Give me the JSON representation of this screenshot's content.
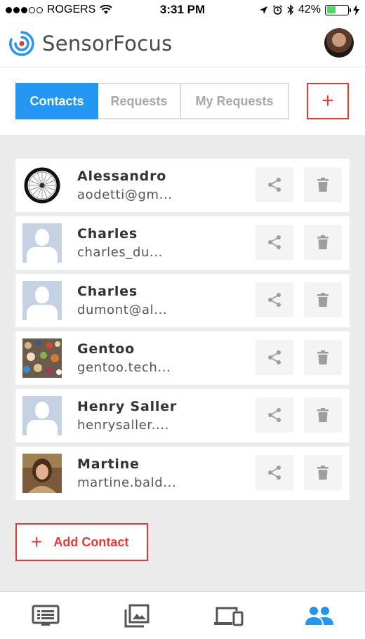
{
  "status_bar": {
    "carrier": "ROGERS",
    "time": "3:31 PM",
    "battery_percent": "42%",
    "battery_level": 0.42
  },
  "header": {
    "app_title": "SensorFocus",
    "logo_icon": "sensor-logo-icon",
    "accent_color": "#2196f3"
  },
  "tabs": [
    {
      "label": "Contacts",
      "active": true
    },
    {
      "label": "Requests",
      "active": false
    },
    {
      "label": "My Requests",
      "active": false
    }
  ],
  "top_add_button": {
    "label": "+",
    "color": "#e53935"
  },
  "contacts": [
    {
      "name": "Alessandro",
      "email": "aodetti@gm...",
      "avatar": "wheel"
    },
    {
      "name": "Charles",
      "email": "charles_du...",
      "avatar": "placeholder"
    },
    {
      "name": "Charles",
      "email": "dumont@al...",
      "avatar": "placeholder"
    },
    {
      "name": "Gentoo",
      "email": "gentoo.tech...",
      "avatar": "crowd"
    },
    {
      "name": "Henry Saller",
      "email": "henrysaller....",
      "avatar": "placeholder"
    },
    {
      "name": "Martine",
      "email": "martine.bald...",
      "avatar": "person"
    }
  ],
  "add_contact": {
    "plus": "+",
    "label": "Add Contact"
  },
  "bottom_nav": [
    {
      "icon": "feed-list-icon",
      "active": false
    },
    {
      "icon": "gallery-icon",
      "active": false
    },
    {
      "icon": "devices-icon",
      "active": false
    },
    {
      "icon": "people-icon",
      "active": true
    }
  ]
}
